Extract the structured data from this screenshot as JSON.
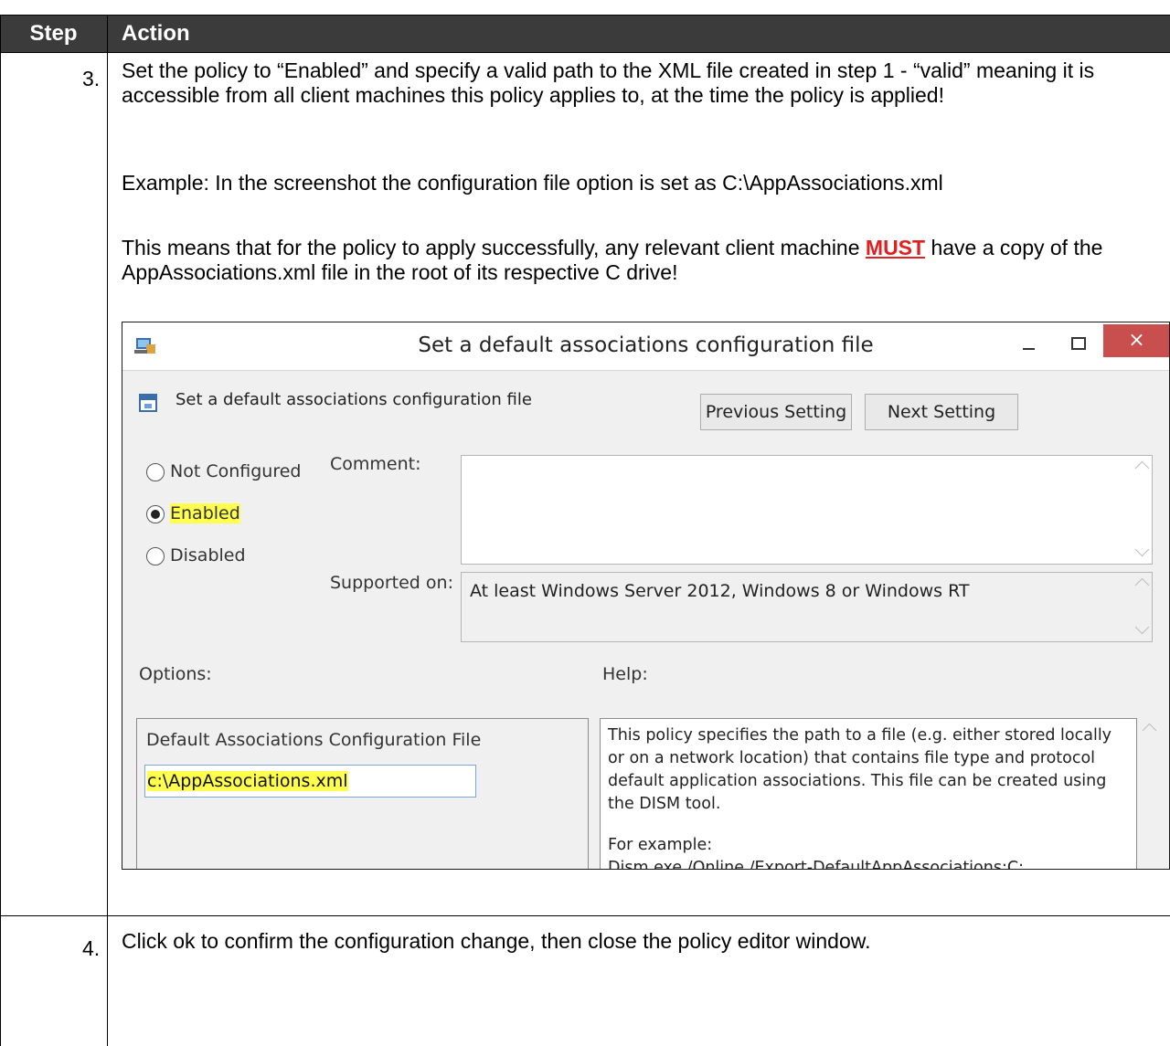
{
  "table": {
    "header": {
      "step": "Step",
      "action": "Action"
    }
  },
  "step3": {
    "number": "3.",
    "paragraph1": "Set the policy to “Enabled” and specify a valid path to the XML file created in step 1 - “valid” meaning it is accessible from all client machines this policy applies to, at the time the policy is applied!",
    "paragraph2": "Example: In the screenshot the configuration file option is set as C:\\AppAssociations.xml",
    "paragraph3_before": "This means that for the policy to apply successfully, any relevant client machine ",
    "paragraph3_emphasis": "MUST",
    "paragraph3_after": " have a copy of the AppAssociations.xml file in the root of its respective C drive!"
  },
  "dialog": {
    "title": "Set a default associations configuration file",
    "setting_name": "Set a default associations configuration file",
    "previous_button": "Previous Setting",
    "next_button": "Next Setting",
    "close_glyph": "×",
    "radios": [
      {
        "label": "Not Configured",
        "selected": false
      },
      {
        "label": "Enabled",
        "selected": true
      },
      {
        "label": "Disabled",
        "selected": false
      }
    ],
    "comment_label": "Comment:",
    "supported_label": "Supported on:",
    "supported_value": "At least Windows Server 2012, Windows 8 or Windows RT",
    "options_label": "Options:",
    "help_label": "Help:",
    "option_field_label": "Default Associations Configuration File",
    "option_field_value": "c:\\AppAssociations.xml",
    "help_text_1": "This policy specifies the path to a file (e.g. either stored locally or on a network location) that contains file type and protocol default application associations. This file can be created using the DISM tool.",
    "help_text_2": "For example:",
    "help_text_3": "Dism.exe /Online /Export-DefaultAppAssociations:C:",
    "highlight_color": "#ffff4d",
    "close_color": "#c94e4e"
  },
  "step4": {
    "number": "4.",
    "text": "Click ok to confirm the configuration change, then close the policy editor window."
  }
}
